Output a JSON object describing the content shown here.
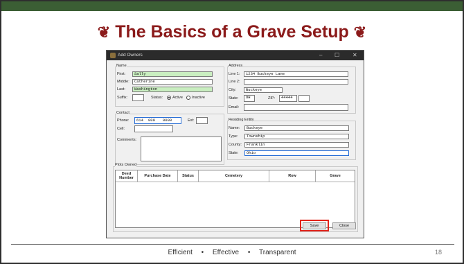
{
  "slide": {
    "title": "The Basics of a Grave Setup",
    "ornament": "❦",
    "footer": {
      "w1": "Efficient",
      "w2": "Effective",
      "w3": "Transparent",
      "sep": "•"
    },
    "page_number": "18"
  },
  "window": {
    "title": "Add Owners",
    "controls": {
      "minimize": "–",
      "maximize": "☐",
      "close": "✕"
    }
  },
  "name": {
    "group": "Name",
    "first_label": "First:",
    "first_value": "Sally",
    "middle_label": "Middle:",
    "middle_value": "Catherine",
    "last_label": "Last:",
    "last_value": "Washington",
    "suffix_label": "Suffix:",
    "suffix_value": "",
    "status_label": "Status:",
    "active_label": "Active",
    "inactive_label": "Inactive",
    "status_selected": "Active"
  },
  "contact": {
    "group": "Contact",
    "phone_label": "Phone:",
    "phone_area": "614",
    "phone_prefix": "000",
    "phone_line": "0000",
    "ext_label": "Ext:",
    "ext_value": "",
    "cell_label": "Cell:",
    "comments_label": "Comments:"
  },
  "address": {
    "group": "Address",
    "line1_label": "Line 1:",
    "line1_value": "1234 Buckeye Lane",
    "line2_label": "Line 2:",
    "line2_value": "",
    "city_label": "City:",
    "city_value": "Buckeye",
    "state_label": "State:",
    "state_value": "OH",
    "zip_label": "ZIP:",
    "zip_value": "44444",
    "email_label": "Email:",
    "email_value": ""
  },
  "residing": {
    "group": "Residing Entity",
    "name_label": "Name:",
    "name_value": "Buckeye",
    "type_label": "Type:",
    "type_value": "Township",
    "county_label": "County:",
    "county_value": "Franklin",
    "state_label": "State:",
    "state_value": "Ohio"
  },
  "plots": {
    "group": "Plots Owned",
    "columns": [
      "Deed\nNumber",
      "Purchase Date",
      "Status",
      "Cemetery",
      "Row",
      "Grave"
    ]
  },
  "buttons": {
    "save": "Save",
    "close": "Close"
  }
}
